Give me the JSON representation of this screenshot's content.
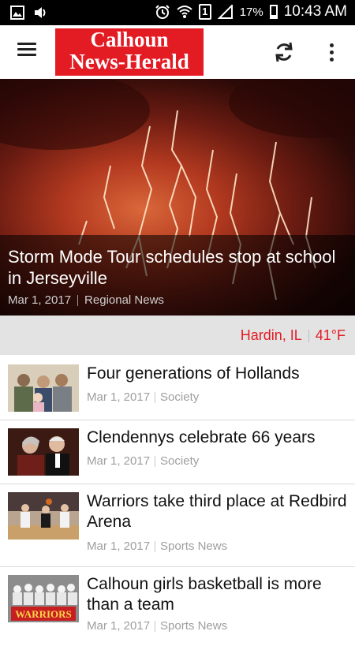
{
  "status_bar": {
    "battery": "17%",
    "time": "10:43 AM",
    "sim_slot": "1"
  },
  "app_bar": {
    "logo_line1": "Calhoun",
    "logo_line2": "News-Herald",
    "logo_color": "#e31b23"
  },
  "hero": {
    "title": "Storm Mode Tour schedules stop at school in Jerseyville",
    "date": "Mar 1, 2017",
    "category": "Regional News"
  },
  "weather": {
    "location": "Hardin, IL",
    "temperature": "41°F"
  },
  "articles": [
    {
      "title": "Four generations of Hollands",
      "date": "Mar 1, 2017",
      "category": "Society"
    },
    {
      "title": "Clendennys celebrate 66 years",
      "date": "Mar 1, 2017",
      "category": "Society"
    },
    {
      "title": "Warriors take third place at Redbird Arena",
      "date": "Mar 1, 2017",
      "category": "Sports News"
    },
    {
      "title": "Calhoun girls basketball is more than a team",
      "date": "Mar 1, 2017",
      "category": "Sports News",
      "thumb_text": "WARRIORS"
    }
  ]
}
